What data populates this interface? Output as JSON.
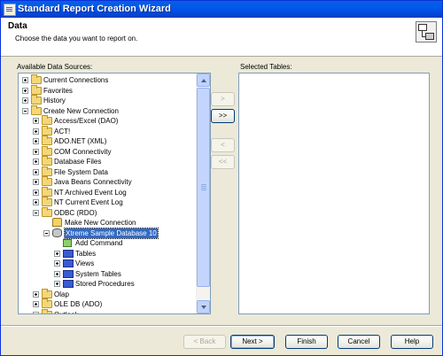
{
  "window": {
    "title": "Standard Report Creation Wizard"
  },
  "header": {
    "title": "Data",
    "subtitle": "Choose the data you want to report on."
  },
  "available": {
    "label": "Available Data Sources:",
    "items": [
      {
        "label": "Current Connections",
        "level": 0,
        "expander": "plus",
        "icon": "folder"
      },
      {
        "label": "Favorites",
        "level": 0,
        "expander": "plus",
        "icon": "folder"
      },
      {
        "label": "History",
        "level": 0,
        "expander": "plus",
        "icon": "folder"
      },
      {
        "label": "Create New Connection",
        "level": 0,
        "expander": "minus",
        "icon": "folder"
      },
      {
        "label": "Access/Excel (DAO)",
        "level": 1,
        "expander": "plus",
        "icon": "folder"
      },
      {
        "label": "ACT!",
        "level": 1,
        "expander": "plus",
        "icon": "folder"
      },
      {
        "label": "ADO.NET (XML)",
        "level": 1,
        "expander": "plus",
        "icon": "folder"
      },
      {
        "label": "COM Connectivity",
        "level": 1,
        "expander": "plus",
        "icon": "folder"
      },
      {
        "label": "Database Files",
        "level": 1,
        "expander": "plus",
        "icon": "folder"
      },
      {
        "label": "File System Data",
        "level": 1,
        "expander": "plus",
        "icon": "folder"
      },
      {
        "label": "Java Beans Connectivity",
        "level": 1,
        "expander": "plus",
        "icon": "folder"
      },
      {
        "label": "NT Archived Event Log",
        "level": 1,
        "expander": "plus",
        "icon": "folder"
      },
      {
        "label": "NT Current Event Log",
        "level": 1,
        "expander": "plus",
        "icon": "folder"
      },
      {
        "label": "ODBC (RDO)",
        "level": 1,
        "expander": "minus",
        "icon": "folder"
      },
      {
        "label": "Make New Connection",
        "level": 2,
        "expander": "none",
        "icon": "make-connection"
      },
      {
        "label": "Xtreme Sample Database 10",
        "level": 2,
        "expander": "minus",
        "icon": "server",
        "selected": true
      },
      {
        "label": "Add Command",
        "level": 3,
        "expander": "none",
        "icon": "command"
      },
      {
        "label": "Tables",
        "level": 3,
        "expander": "plus",
        "icon": "db"
      },
      {
        "label": "Views",
        "level": 3,
        "expander": "plus",
        "icon": "db"
      },
      {
        "label": "System Tables",
        "level": 3,
        "expander": "plus",
        "icon": "db"
      },
      {
        "label": "Stored Procedures",
        "level": 3,
        "expander": "plus",
        "icon": "db"
      },
      {
        "label": "Olap",
        "level": 1,
        "expander": "plus",
        "icon": "folder"
      },
      {
        "label": "OLE DB (ADO)",
        "level": 1,
        "expander": "plus",
        "icon": "folder"
      },
      {
        "label": "Outlook",
        "level": 1,
        "expander": "plus",
        "icon": "folder"
      }
    ]
  },
  "selected_tables": {
    "label": "Selected Tables:"
  },
  "transfer": {
    "add_one": ">",
    "add_all": ">>",
    "remove_one": "<",
    "remove_all": "<<"
  },
  "buttons": {
    "back": "< Back",
    "next": "Next >",
    "finish": "Finish",
    "cancel": "Cancel",
    "help": "Help"
  }
}
